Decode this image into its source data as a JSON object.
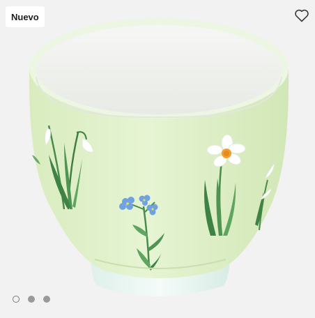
{
  "badge": {
    "label": "Nuevo"
  },
  "favorite": {
    "icon": "heart-outline-icon"
  },
  "gallery": {
    "image_count": 3,
    "active_index": 0
  },
  "colors": {
    "background": "#f2f2f2",
    "cup_body": "#e2f1cd",
    "cup_inner": "#f1f2ef",
    "badge_bg": "#ffffff"
  }
}
